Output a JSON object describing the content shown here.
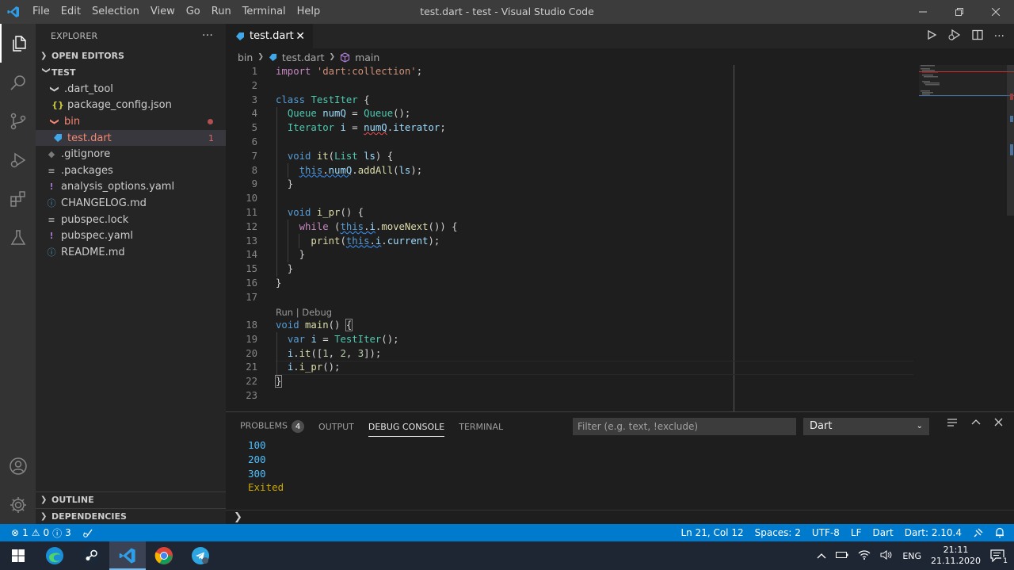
{
  "window": {
    "menu": [
      "File",
      "Edit",
      "Selection",
      "View",
      "Go",
      "Run",
      "Terminal",
      "Help"
    ],
    "title": "test.dart - test - Visual Studio Code"
  },
  "sidebar": {
    "header": "EXPLORER",
    "open_editors": "OPEN EDITORS",
    "folder": "TEST",
    "items": [
      {
        "label": ".dart_tool"
      },
      {
        "label": "package_config.json"
      },
      {
        "label": "bin"
      },
      {
        "label": "test.dart",
        "problems": "1"
      },
      {
        "label": ".gitignore"
      },
      {
        "label": ".packages"
      },
      {
        "label": "analysis_options.yaml"
      },
      {
        "label": "CHANGELOG.md"
      },
      {
        "label": "pubspec.lock"
      },
      {
        "label": "pubspec.yaml"
      },
      {
        "label": "README.md"
      }
    ],
    "outline": "OUTLINE",
    "dependencies": "DEPENDENCIES"
  },
  "editor": {
    "tab": "test.dart",
    "breadcrumb": [
      "bin",
      "test.dart",
      "main"
    ],
    "codelens": "Run | Debug",
    "line_numbers": [
      "1",
      "2",
      "3",
      "4",
      "5",
      "6",
      "7",
      "8",
      "9",
      "10",
      "11",
      "12",
      "13",
      "14",
      "15",
      "16",
      "17",
      "18",
      "19",
      "20",
      "21",
      "22",
      "23"
    ]
  },
  "panel": {
    "tabs": [
      "PROBLEMS",
      "OUTPUT",
      "DEBUG CONSOLE",
      "TERMINAL"
    ],
    "problems_count": "4",
    "filter_placeholder": "Filter (e.g. text, !exclude)",
    "dropdown": "Dart",
    "output": [
      "100",
      "200",
      "300"
    ],
    "exited": "Exited"
  },
  "status": {
    "errors": "1",
    "warnings": "0",
    "infos": "3",
    "position": "Ln 21, Col 12",
    "spaces": "Spaces: 2",
    "encoding": "UTF-8",
    "eol": "LF",
    "language": "Dart",
    "sdk": "Dart: 2.10.4"
  },
  "taskbar": {
    "lang": "ENG",
    "time": "21:11",
    "date": "21.11.2020",
    "notif_count": "1"
  },
  "colors": {
    "activity_bar": "#333333",
    "sidebar": "#252526",
    "editor": "#1e1e1e",
    "status_bar": "#007acc",
    "taskbar": "#1f2633"
  }
}
